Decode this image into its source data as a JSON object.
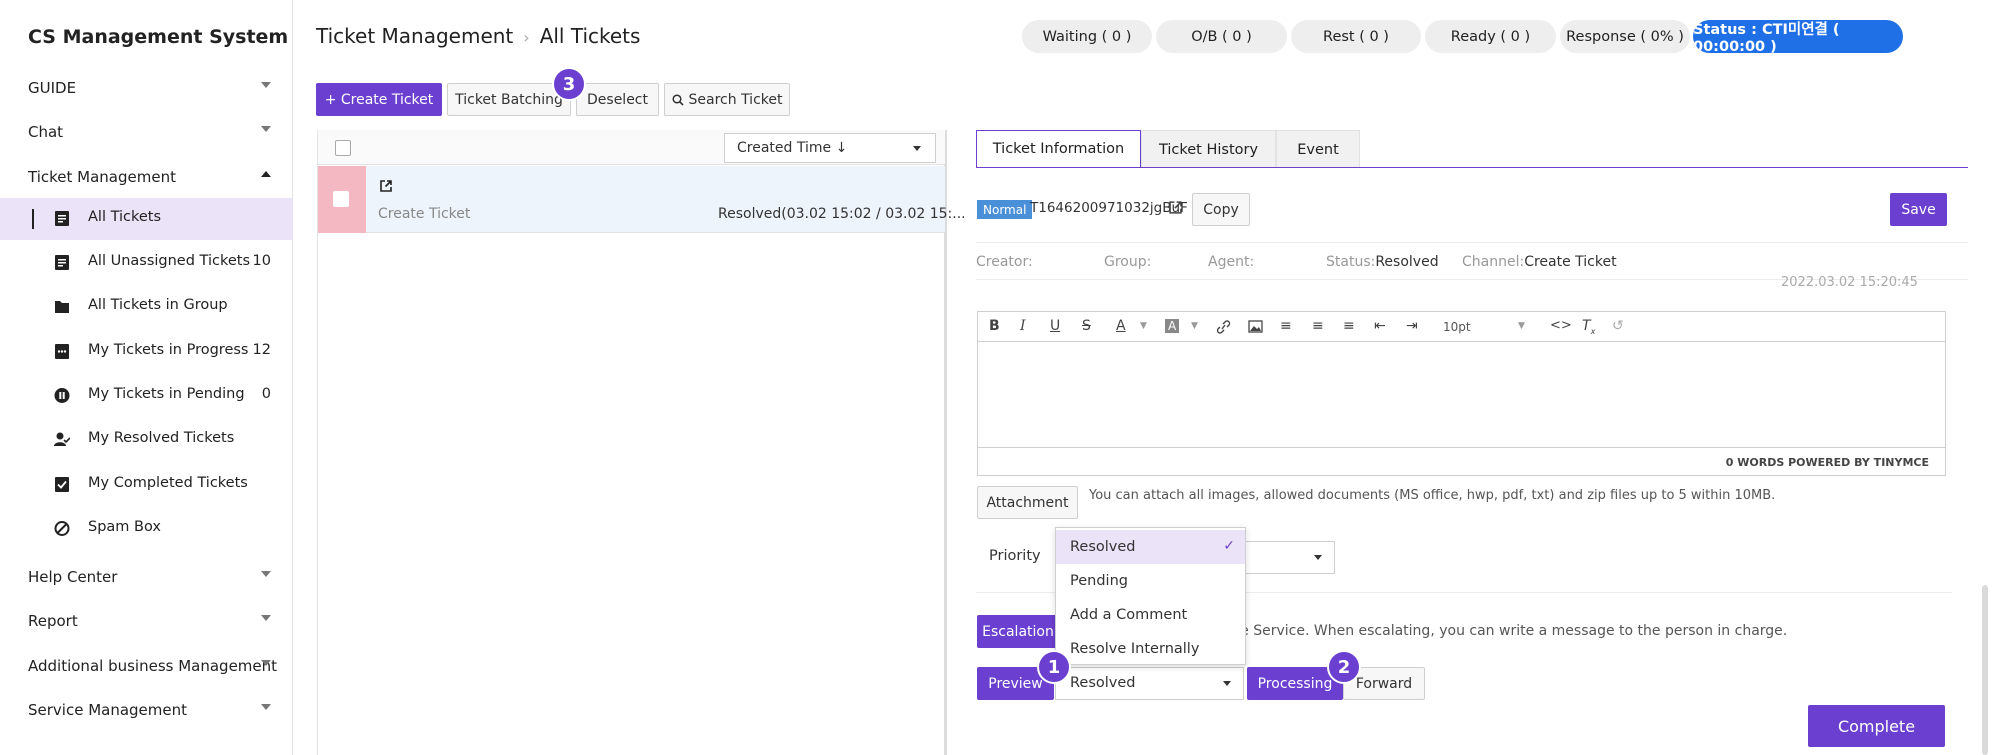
{
  "app_title": "CS Management System",
  "sidebar": {
    "guide": "GUIDE",
    "chat": "Chat",
    "ticket_management": "Ticket Management",
    "sub_items": [
      {
        "label": "All Tickets",
        "count": ""
      },
      {
        "label": "All Unassigned Tickets",
        "count": "10"
      },
      {
        "label": "All Tickets in Group",
        "count": ""
      },
      {
        "label": "My Tickets in Progress",
        "count": "12"
      },
      {
        "label": "My Tickets in Pending",
        "count": "0"
      },
      {
        "label": "My Resolved Tickets",
        "count": ""
      },
      {
        "label": "My Completed Tickets",
        "count": ""
      },
      {
        "label": "Spam Box",
        "count": ""
      }
    ],
    "help_center": "Help Center",
    "report": "Report",
    "additional": "Additional business Management",
    "service": "Service Management"
  },
  "header": {
    "crumb_parent": "Ticket Management",
    "crumb_current": "All Tickets",
    "pills": {
      "waiting": "Waiting ( 0 )",
      "ob": "O/B ( 0 )",
      "rest": "Rest ( 0 )",
      "ready": "Ready ( 0 )",
      "response": "Response ( 0% )",
      "status": "Status : CTI미연결 ( 00:00:00 )"
    }
  },
  "toolbar": {
    "create": "+ Create Ticket",
    "batching": "Ticket Batching",
    "deselect": "Deselect",
    "search": "Search Ticket"
  },
  "badges": {
    "one": "1",
    "two": "2",
    "three": "3"
  },
  "list": {
    "sort": "Created Time ↓",
    "row": {
      "title": "Create Ticket",
      "status": "Resolved(03.02 15:02 / 03.02 15:..."
    }
  },
  "detail": {
    "tabs": {
      "info": "Ticket Information",
      "history": "Ticket History",
      "event": "Event"
    },
    "priority_tag": "Normal",
    "ticket_id": "T1646200971032jgBuF",
    "copy": "Copy",
    "save": "Save",
    "info": {
      "creator_label": "Creator:",
      "group_label": "Group:",
      "agent_label": "Agent:",
      "status_label": "Status:",
      "status_value": "Resolved",
      "channel_label": "Channel:",
      "channel_value": "Create Ticket"
    },
    "timestamp": "2022.03.02 15:20:45",
    "editor": {
      "font_size": "10pt",
      "footer": "0 WORDS POWERED BY TINYMCE"
    },
    "attachment": "Attachment",
    "attachment_note": "You can attach all images, allowed documents (MS office, hwp, pdf, txt) and zip files up to 5 within 10MB.",
    "priority_label": "Priority",
    "escalation": "Escalation",
    "escalation_note": "sue Service. When escalating, you can write a message to the person in charge.",
    "dropdown_options": [
      "Resolved",
      "Pending",
      "Add a Comment",
      "Resolve Internally"
    ],
    "preview": "Preview",
    "status_select": "Resolved",
    "processing": "Processing",
    "forward": "Forward",
    "complete": "Complete"
  }
}
